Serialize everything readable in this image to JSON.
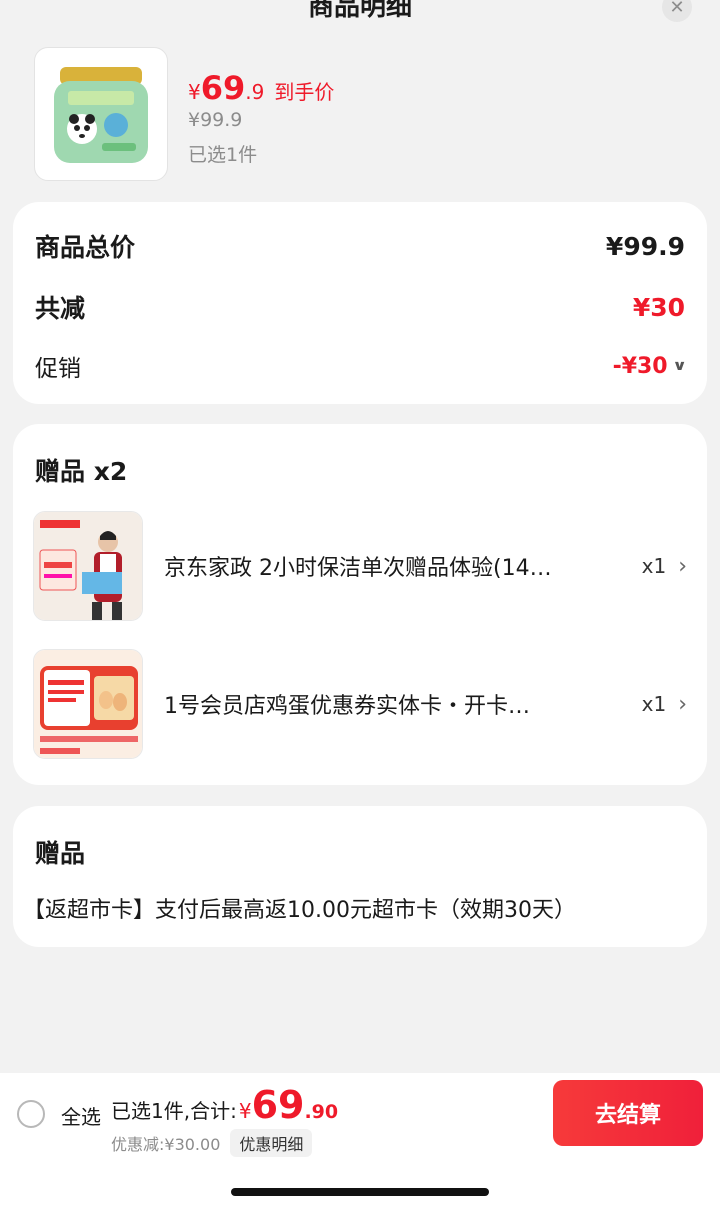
{
  "sheet": {
    "title": "商品明细",
    "close_label": "✕"
  },
  "product": {
    "price_currency": "¥",
    "price_int": "69",
    "price_dec": ".9",
    "price_tag": "到手价",
    "original_price": "¥99.9",
    "selected": "已选1件"
  },
  "summary_card": {
    "total_label": "商品总价",
    "total_value": "¥99.9",
    "reduce_label": "共减",
    "reduce_value": "¥30",
    "promo_label": "促销",
    "promo_value": "-¥30"
  },
  "gifts_card": {
    "title": "赠品 x2",
    "items": [
      {
        "name": "京东家政 2小时保洁单次赠品体验(14…",
        "qty": "x1"
      },
      {
        "name": "1号会员店鸡蛋优惠券实体卡・开卡…",
        "qty": "x1"
      }
    ]
  },
  "gift_note_card": {
    "title": "赠品",
    "note": "【返超市卡】支付后最高返10.00元超市卡（效期30天）"
  },
  "footer": {
    "select_all": "全选",
    "summary_text": "已选1件,合计:",
    "currency": "¥",
    "total_int": "69",
    "total_dec": ".90",
    "discount_text": "优惠减:¥30.00",
    "discount_detail": "优惠明细",
    "checkout": "去结算"
  },
  "colors": {
    "accent": "#ef1a2a",
    "background": "#f2f2f2"
  }
}
